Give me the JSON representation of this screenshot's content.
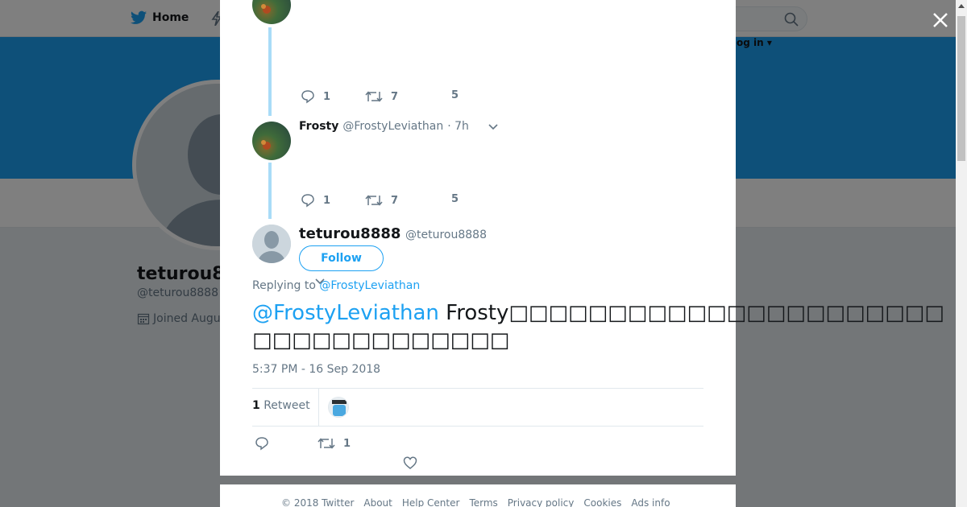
{
  "nav": {
    "home_label": "Home",
    "login_label": "og in ▾"
  },
  "profile": {
    "name": "teturou8",
    "handle": "@teturou8888",
    "joined": "Joined Augu"
  },
  "thread": [
    {
      "replies": "1",
      "retweets": "7",
      "likes": "5"
    },
    {
      "name": "Frosty",
      "handle": "@FrostyLeviathan",
      "time": "· 7h",
      "replies": "1",
      "retweets": "7",
      "likes": "5"
    }
  ],
  "focused": {
    "name": "teturou8888",
    "handle": "@teturou8888",
    "follow_label": "Follow",
    "replying_prefix": "Replying to",
    "replying_to": "@FrostyLeviathan",
    "mention": "@FrostyLeviathan",
    "text": " Frosty□□□□□□□□□□□□□□□□□□□□□□□□□□□□□□□□□□□",
    "timestamp": "5:37 PM - 16 Sep 2018",
    "retweet_count": "1",
    "retweet_label": "Retweet",
    "actions": {
      "retweets": "1"
    }
  },
  "footer": {
    "links": [
      "© 2018 Twitter",
      "About",
      "Help Center",
      "Terms",
      "Privacy policy",
      "Cookies",
      "Ads info"
    ]
  },
  "colors": {
    "brand": "#1da1f2",
    "thread_line": "#a9dcf7",
    "muted": "#657786"
  }
}
